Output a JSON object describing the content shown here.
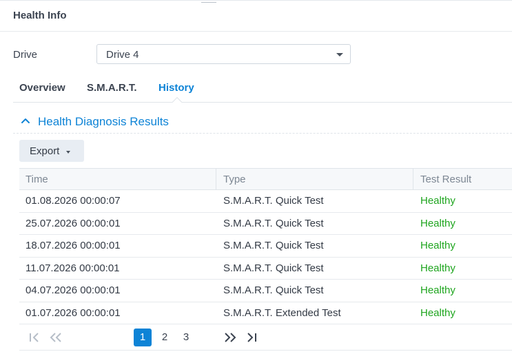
{
  "panel": {
    "title": "Health Info"
  },
  "drive": {
    "label": "Drive",
    "selected": "Drive 4"
  },
  "tabs": [
    {
      "label": "Overview",
      "active": false
    },
    {
      "label": "S.M.A.R.T.",
      "active": false
    },
    {
      "label": "History",
      "active": true
    }
  ],
  "section": {
    "title": "Health Diagnosis Results"
  },
  "toolbar": {
    "export_label": "Export"
  },
  "table": {
    "columns": [
      "Time",
      "Type",
      "Test Result"
    ],
    "rows": [
      [
        "01.08.2026 00:00:07",
        "S.M.A.R.T. Quick Test",
        "Healthy"
      ],
      [
        "25.07.2026 00:00:01",
        "S.M.A.R.T. Quick Test",
        "Healthy"
      ],
      [
        "18.07.2026 00:00:01",
        "S.M.A.R.T. Quick Test",
        "Healthy"
      ],
      [
        "11.07.2026 00:00:01",
        "S.M.A.R.T. Quick Test",
        "Healthy"
      ],
      [
        "04.07.2026 00:00:01",
        "S.M.A.R.T. Quick Test",
        "Healthy"
      ],
      [
        "01.07.2026 00:00:01",
        "S.M.A.R.T. Extended Test",
        "Healthy"
      ]
    ]
  },
  "pagination": {
    "pages": [
      "1",
      "2",
      "3"
    ],
    "current": "1",
    "icons": [
      "first-page-icon",
      "previous-page-icon",
      "next-page-icon",
      "last-page-icon"
    ]
  },
  "colors": {
    "accent": "#0d83d6",
    "healthy": "#1ea51e",
    "text": "#333a45"
  }
}
